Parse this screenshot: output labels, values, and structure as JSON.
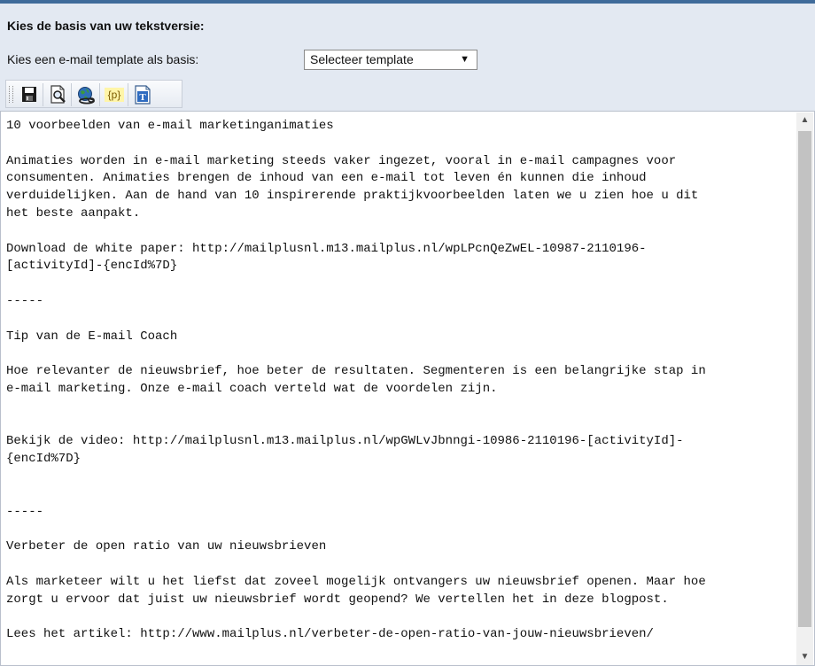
{
  "form": {
    "heading": "Kies de basis van uw tekstversie:",
    "template_label": "Kies een e-mail template als basis:",
    "template_select": {
      "selected": "Selecteer template",
      "arrow": "▼"
    }
  },
  "toolbar": {
    "tools": [
      {
        "name": "save-icon"
      },
      {
        "name": "preview-icon"
      },
      {
        "name": "globe-link-icon"
      },
      {
        "name": "placeholder-p-icon"
      },
      {
        "name": "text-format-icon"
      }
    ],
    "placeholder_glyph": "{p}",
    "text_glyph": "T"
  },
  "editor": {
    "lines": [
      "10 voorbeelden van e-mail marketinganimaties",
      "",
      "Animaties worden in e-mail marketing steeds vaker ingezet, vooral in e-mail campagnes voor",
      "consumenten. Animaties brengen de inhoud van een e-mail tot leven én kunnen die inhoud",
      "verduidelijken. Aan de hand van 10 inspirerende praktijkvoorbeelden laten we u zien hoe u dit",
      "het beste aanpakt.",
      "",
      "Download de white paper: http://mailplusnl.m13.mailplus.nl/wpLPcnQeZwEL-10987-2110196-",
      "[activityId]-{encId%7D}",
      "",
      "-----",
      "",
      "Tip van de E-mail Coach",
      "",
      "Hoe relevanter de nieuwsbrief, hoe beter de resultaten. Segmenteren is een belangrijke stap in",
      "e-mail marketing. Onze e-mail coach verteld wat de voordelen zijn.",
      "",
      "",
      "Bekijk de video: http://mailplusnl.m13.mailplus.nl/wpGWLvJbnngi-10986-2110196-[activityId]-",
      "{encId%7D}",
      "",
      "",
      "-----",
      "",
      "Verbeter de open ratio van uw nieuwsbrieven",
      "",
      "Als marketeer wilt u het liefst dat zoveel mogelijk ontvangers uw nieuwsbrief openen. Maar hoe",
      "zorgt u ervoor dat juist uw nieuwsbrief wordt geopend? We vertellen het in deze blogpost.",
      "",
      "Lees het artikel: http://www.mailplus.nl/verbeter-de-open-ratio-van-jouw-nieuwsbrieven/"
    ],
    "scroll_up": "▲",
    "scroll_down": "▼"
  },
  "colors": {
    "accent": "#3f6b9a",
    "panel_bg": "#e3e9f2"
  }
}
